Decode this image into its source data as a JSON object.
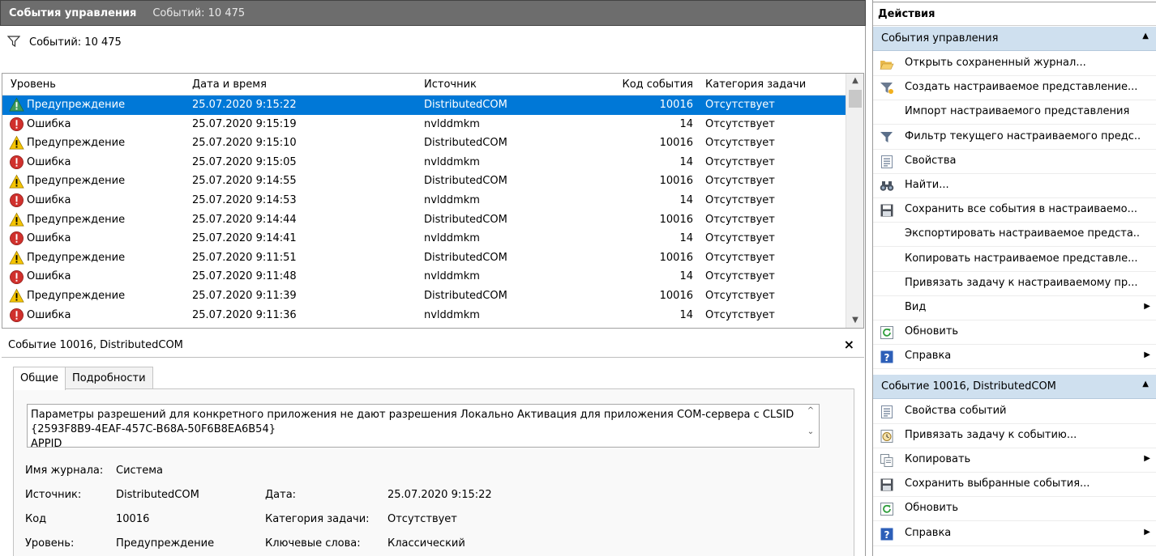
{
  "title": {
    "main": "События управления",
    "count": "Событий: 10 475"
  },
  "filter_bar": {
    "text": "Событий: 10 475"
  },
  "grid": {
    "columns": [
      "Уровень",
      "Дата и время",
      "Источник",
      "Код события",
      "Категория задачи"
    ],
    "rows": [
      {
        "level": "Предупреждение",
        "type": "warning",
        "date": "25.07.2020 9:15:22",
        "source": "DistributedCOM",
        "code": "10016",
        "category": "Отсутствует",
        "selected": true
      },
      {
        "level": "Ошибка",
        "type": "error",
        "date": "25.07.2020 9:15:19",
        "source": "nvlddmkm",
        "code": "14",
        "category": "Отсутствует"
      },
      {
        "level": "Предупреждение",
        "type": "warning",
        "date": "25.07.2020 9:15:10",
        "source": "DistributedCOM",
        "code": "10016",
        "category": "Отсутствует"
      },
      {
        "level": "Ошибка",
        "type": "error",
        "date": "25.07.2020 9:15:05",
        "source": "nvlddmkm",
        "code": "14",
        "category": "Отсутствует"
      },
      {
        "level": "Предупреждение",
        "type": "warning",
        "date": "25.07.2020 9:14:55",
        "source": "DistributedCOM",
        "code": "10016",
        "category": "Отсутствует"
      },
      {
        "level": "Ошибка",
        "type": "error",
        "date": "25.07.2020 9:14:53",
        "source": "nvlddmkm",
        "code": "14",
        "category": "Отсутствует"
      },
      {
        "level": "Предупреждение",
        "type": "warning",
        "date": "25.07.2020 9:14:44",
        "source": "DistributedCOM",
        "code": "10016",
        "category": "Отсутствует"
      },
      {
        "level": "Ошибка",
        "type": "error",
        "date": "25.07.2020 9:14:41",
        "source": "nvlddmkm",
        "code": "14",
        "category": "Отсутствует"
      },
      {
        "level": "Предупреждение",
        "type": "warning",
        "date": "25.07.2020 9:11:51",
        "source": "DistributedCOM",
        "code": "10016",
        "category": "Отсутствует"
      },
      {
        "level": "Ошибка",
        "type": "error",
        "date": "25.07.2020 9:11:48",
        "source": "nvlddmkm",
        "code": "14",
        "category": "Отсутствует"
      },
      {
        "level": "Предупреждение",
        "type": "warning",
        "date": "25.07.2020 9:11:39",
        "source": "DistributedCOM",
        "code": "10016",
        "category": "Отсутствует"
      },
      {
        "level": "Ошибка",
        "type": "error",
        "date": "25.07.2020 9:11:36",
        "source": "nvlddmkm",
        "code": "14",
        "category": "Отсутствует"
      }
    ]
  },
  "detail": {
    "title": "Событие 10016, DistributedCOM",
    "close": "×",
    "tabs": [
      "Общие",
      "Подробности"
    ],
    "message_line1": "Параметры разрешений для конкретного приложения не дают разрешения Локально Активация для приложения COM-сервера с CLSID",
    "message_line2": "{2593F8B9-4EAF-457C-B68A-50F6B8EA6B54}",
    "message_line3": "  APPID",
    "props": {
      "log_label": "Имя журнала:",
      "log_value": "Система",
      "source_label": "Источник:",
      "source_value": "DistributedCOM",
      "date_label": "Дата:",
      "date_value": "25.07.2020 9:15:22",
      "code_label": "Код",
      "code_value": "10016",
      "cat_label": "Категория задачи:",
      "cat_value": "Отсутствует",
      "level_label": "Уровень:",
      "level_value": "Предупреждение",
      "kw_label": "Ключевые слова:",
      "kw_value": "Классический"
    }
  },
  "actions": {
    "title": "Действия",
    "section1": "События управления",
    "items1": [
      {
        "label": "Открыть сохраненный журнал...",
        "icon": "folder-open-icon"
      },
      {
        "label": "Создать настраиваемое представление...",
        "icon": "funnel-star-icon"
      },
      {
        "label": "Импорт настраиваемого представления",
        "icon": ""
      },
      {
        "label": "Фильтр текущего настраиваемого предс...",
        "icon": "funnel-icon"
      },
      {
        "label": "Свойства",
        "icon": "properties-icon"
      },
      {
        "label": "Найти...",
        "icon": "binoculars-icon"
      },
      {
        "label": "Сохранить все события в настраиваемо...",
        "icon": "floppy-icon"
      },
      {
        "label": "Экспортировать настраиваемое предста...",
        "icon": ""
      },
      {
        "label": "Копировать настраиваемое представле...",
        "icon": ""
      },
      {
        "label": "Привязать задачу к настраиваемому пр...",
        "icon": ""
      },
      {
        "label": "Вид",
        "icon": "",
        "submenu": true
      },
      {
        "label": "Обновить",
        "icon": "refresh-icon"
      },
      {
        "label": "Справка",
        "icon": "help-icon",
        "submenu": true
      }
    ],
    "section2": "Событие 10016, DistributedCOM",
    "items2": [
      {
        "label": "Свойства событий",
        "icon": "properties-icon"
      },
      {
        "label": "Привязать задачу к событию...",
        "icon": "task-clock-icon"
      },
      {
        "label": "Копировать",
        "icon": "copy-icon",
        "submenu": true
      },
      {
        "label": "Сохранить выбранные события...",
        "icon": "floppy-icon"
      },
      {
        "label": "Обновить",
        "icon": "refresh-icon"
      },
      {
        "label": "Справка",
        "icon": "help-icon",
        "submenu": true
      }
    ]
  },
  "colors": {
    "selection": "#0078d7",
    "section_bg": "#cfe0ef",
    "title_bg": "#6d6d6d"
  }
}
